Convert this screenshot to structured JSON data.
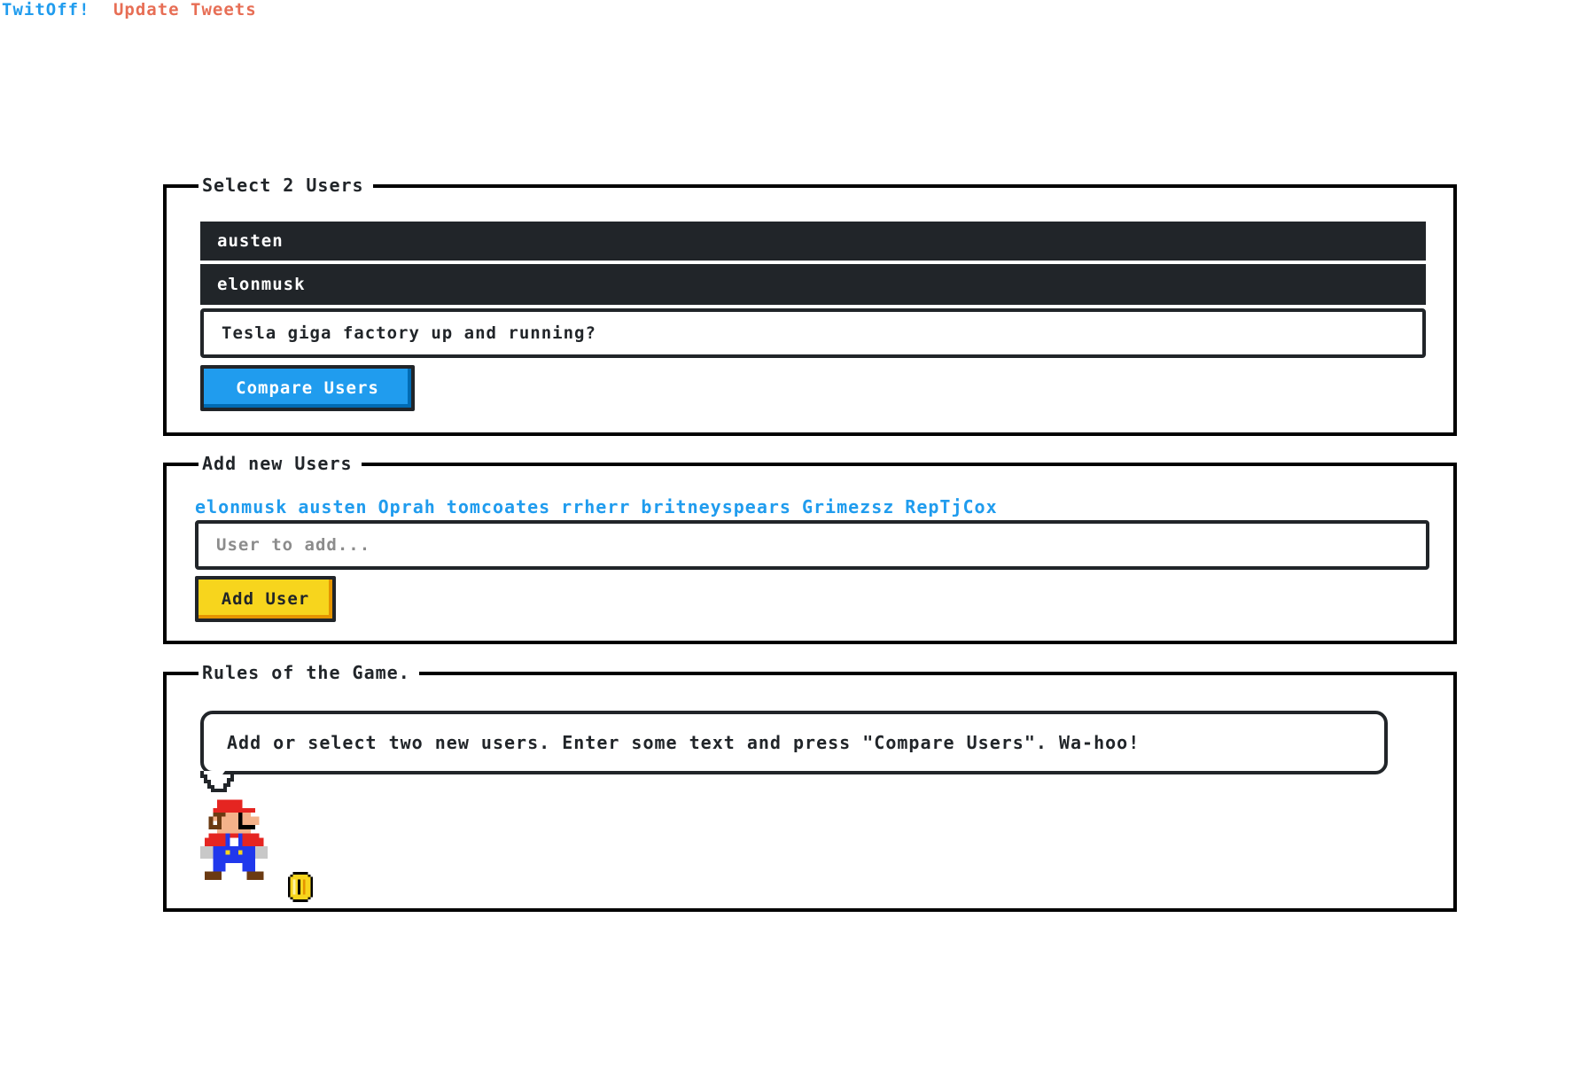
{
  "nav": {
    "brand": "TwitOff!",
    "update": "Update Tweets"
  },
  "select_panel": {
    "title": "Select 2 Users",
    "options": [
      "austen",
      "elonmusk"
    ],
    "text_value": "Tesla giga factory up and running?",
    "compare_label": "Compare Users"
  },
  "add_panel": {
    "title": "Add new Users",
    "users": [
      "elonmusk",
      "austen",
      "Oprah",
      "tomcoates",
      "rrherr",
      "britneyspears",
      "Grimezsz",
      "RepTjCox"
    ],
    "input_placeholder": "User to add...",
    "add_label": "Add User"
  },
  "rules_panel": {
    "title": "Rules of the Game.",
    "message": "Add or select two new users. Enter some text and press \"Compare Users\". Wa-hoo!"
  },
  "colors": {
    "primary": "#209cee",
    "warning": "#f7d51d",
    "dark": "#212529",
    "nav_update": "#e76e55"
  },
  "icons": {
    "mario": "mario-sprite-icon",
    "coin": "coin-icon"
  }
}
